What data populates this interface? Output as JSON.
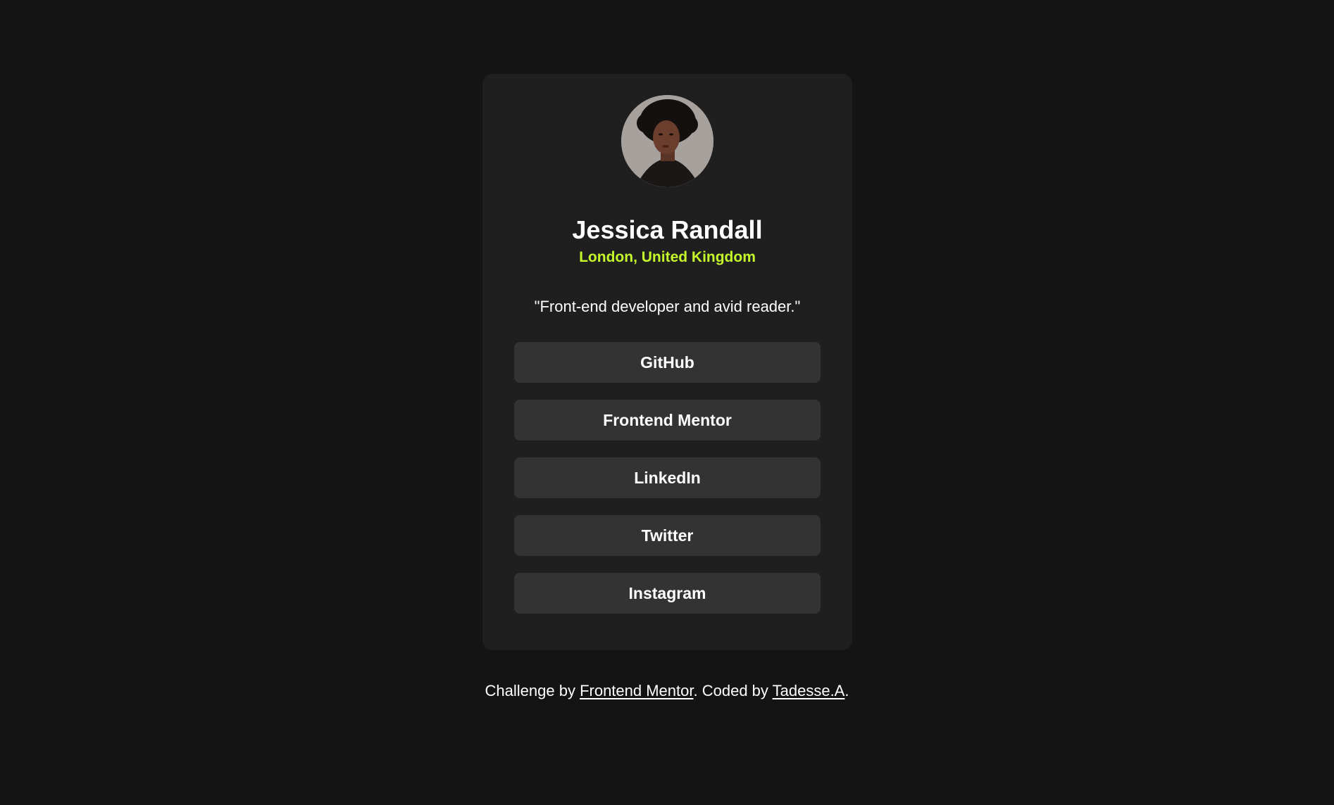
{
  "profile": {
    "name": "Jessica Randall",
    "location": "London, United Kingdom",
    "bio": "\"Front-end developer and avid reader.\""
  },
  "links": [
    {
      "label": "GitHub"
    },
    {
      "label": "Frontend Mentor"
    },
    {
      "label": "LinkedIn"
    },
    {
      "label": "Twitter"
    },
    {
      "label": "Instagram"
    }
  ],
  "footer": {
    "prefix": "Challenge by ",
    "challenge_link": "Frontend Mentor",
    "middle": ". Coded by ",
    "author_link": "Tadesse.A",
    "suffix": "."
  },
  "colors": {
    "background": "#141414",
    "card": "#1f1f1f",
    "button": "#333333",
    "accent": "#c4f82a",
    "text": "#ffffff"
  }
}
